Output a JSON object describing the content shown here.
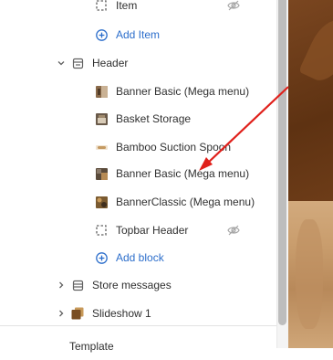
{
  "sidebar": {
    "items": [
      {
        "label": "Item",
        "icon": "dashed-square-icon",
        "hidden": true
      },
      {
        "label": "Add Item",
        "icon": "plus-circle-icon"
      },
      {
        "label": "Header",
        "icon": "section-icon",
        "expanded": true
      },
      {
        "label": "Banner Basic (Mega menu)",
        "icon": "thumbnail-icon"
      },
      {
        "label": "Basket Storage",
        "icon": "thumbnail-icon"
      },
      {
        "label": "Bamboo Suction Spoon",
        "icon": "thumbnail-icon"
      },
      {
        "label": "Banner Basic (Mega menu)",
        "icon": "thumbnail-icon"
      },
      {
        "label": "BannerClassic (Mega menu)",
        "icon": "thumbnail-icon"
      },
      {
        "label": "Topbar Header",
        "icon": "dashed-square-icon",
        "hidden": true
      },
      {
        "label": "Add block",
        "icon": "plus-circle-icon"
      },
      {
        "label": "Store messages",
        "icon": "section-icon",
        "expanded": false
      },
      {
        "label": "Slideshow 1",
        "icon": "slideshow-icon",
        "expanded": false
      }
    ],
    "footer_label": "Template"
  },
  "colors": {
    "accent": "#2c6ecb",
    "arrow": "#e0201b",
    "text": "#303030"
  }
}
